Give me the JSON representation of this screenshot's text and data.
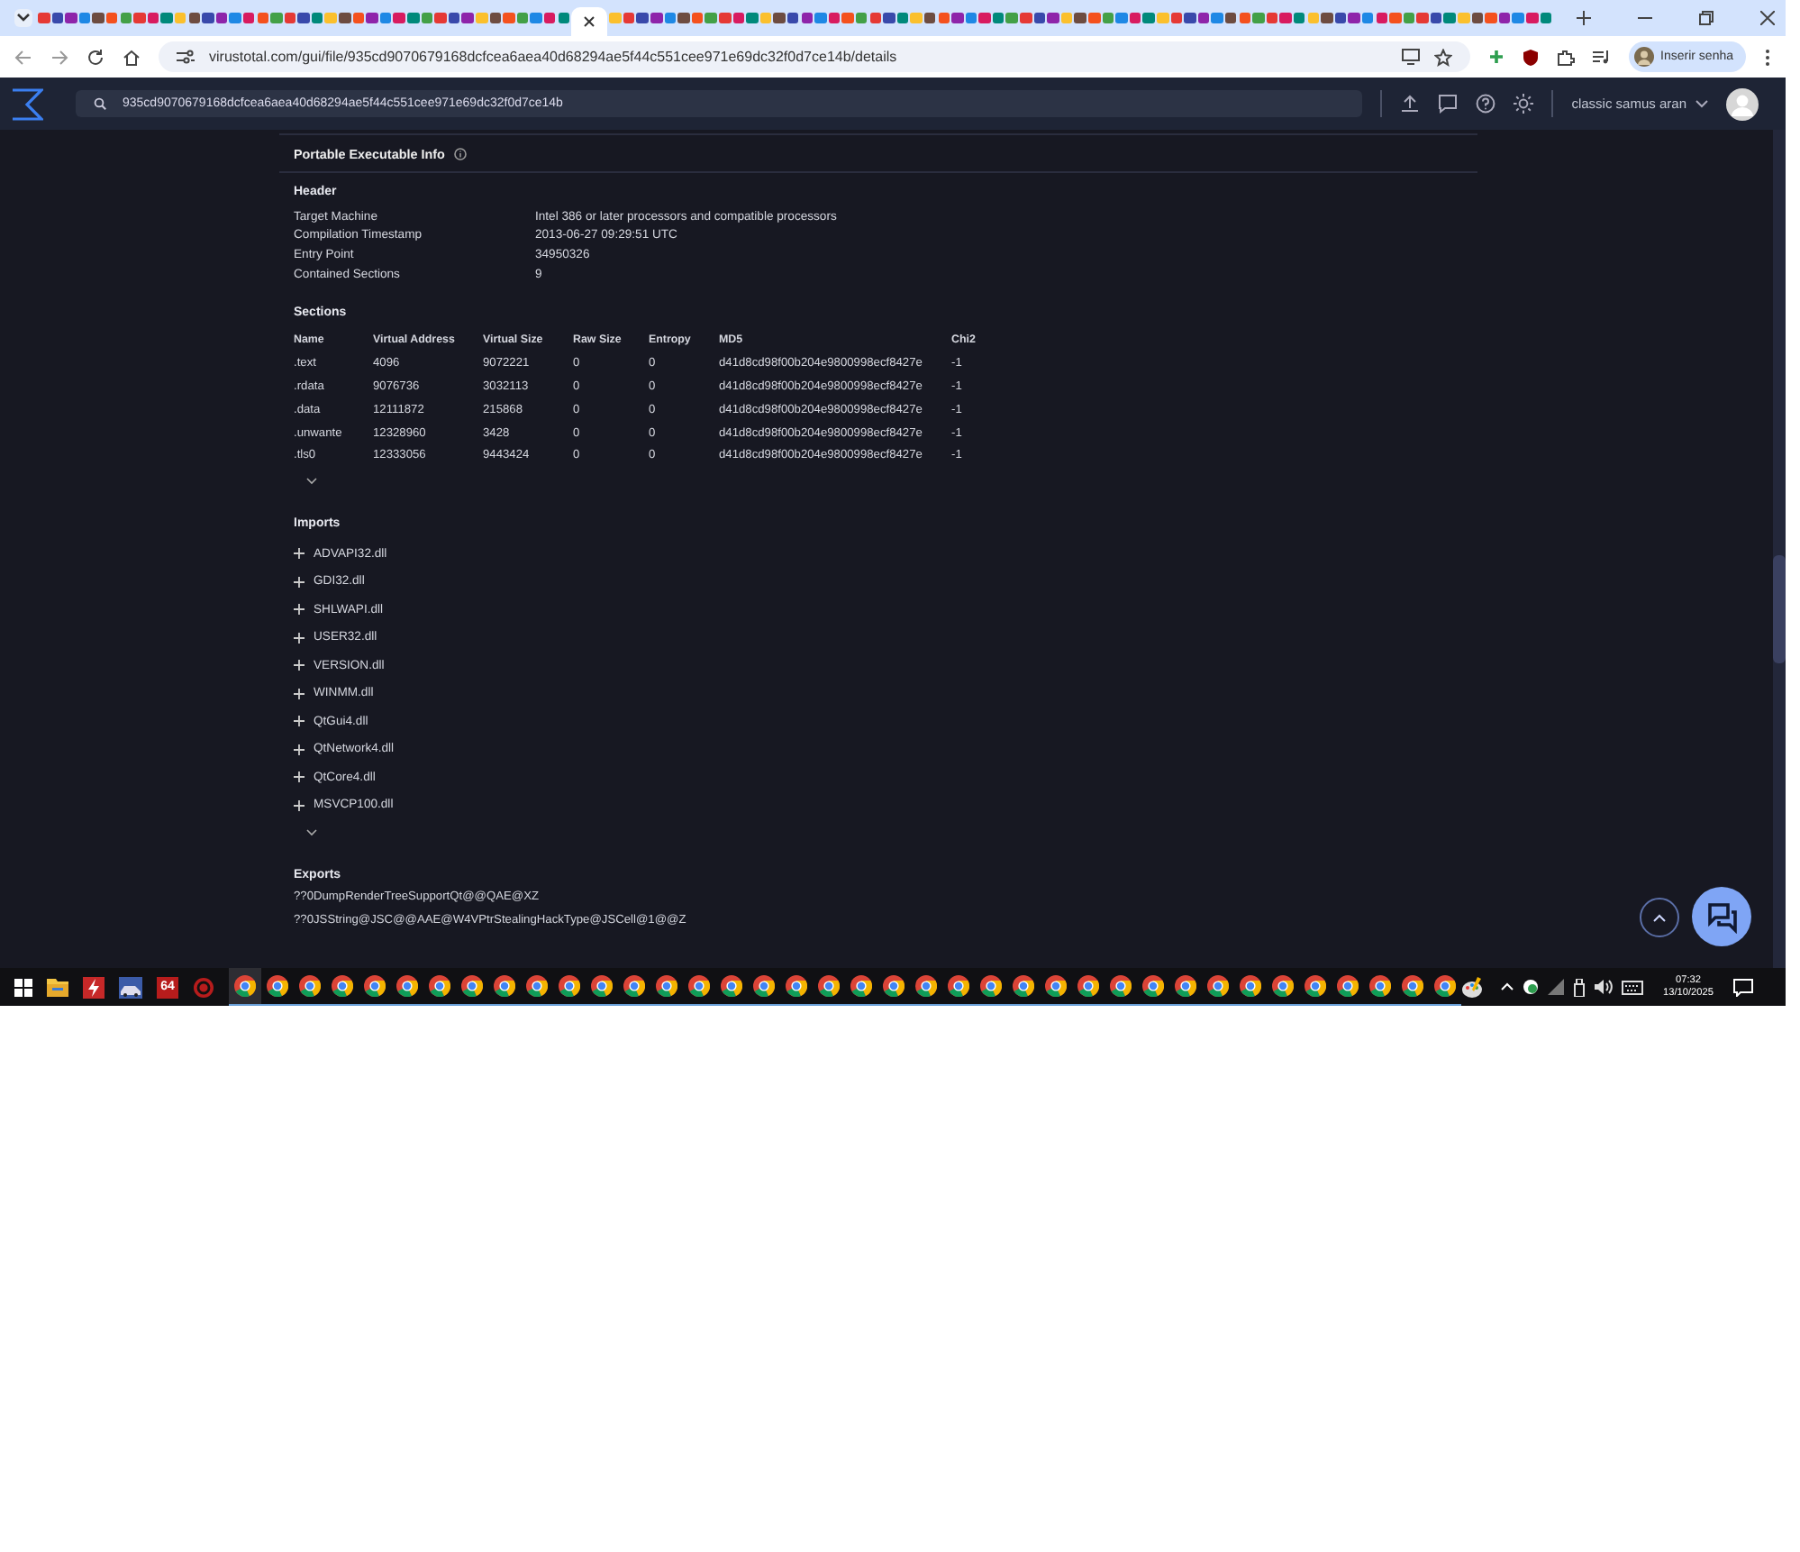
{
  "browser": {
    "url": "virustotal.com/gui/file/935cd9070679168dcfcea6aea40d68294ae5f44c551cee971e69dc32f0d7ce14b/details",
    "profile": "Inserir senha"
  },
  "header": {
    "search": "935cd9070679168dcfcea6aea40d68294ae5f44c551cee971e69dc32f0d7ce14b",
    "user": "classic samus aran"
  },
  "pe_info": {
    "title": "Portable Executable Info",
    "header": {
      "title": "Header",
      "rows": [
        {
          "label": "Target Machine",
          "value": "Intel 386 or later processors and compatible processors"
        },
        {
          "label": "Compilation Timestamp",
          "value": "2013-06-27 09:29:51 UTC"
        },
        {
          "label": "Entry Point",
          "value": "34950326"
        },
        {
          "label": "Contained Sections",
          "value": "9"
        }
      ]
    },
    "sections": {
      "title": "Sections",
      "columns": [
        "Name",
        "Virtual Address",
        "Virtual Size",
        "Raw Size",
        "Entropy",
        "MD5",
        "Chi2"
      ],
      "rows": [
        [
          ".text",
          "4096",
          "9072221",
          "0",
          "0",
          "d41d8cd98f00b204e9800998ecf8427e",
          "-1"
        ],
        [
          ".rdata",
          "9076736",
          "3032113",
          "0",
          "0",
          "d41d8cd98f00b204e9800998ecf8427e",
          "-1"
        ],
        [
          ".data",
          "12111872",
          "215868",
          "0",
          "0",
          "d41d8cd98f00b204e9800998ecf8427e",
          "-1"
        ],
        [
          ".unwante",
          "12328960",
          "3428",
          "0",
          "0",
          "d41d8cd98f00b204e9800998ecf8427e",
          "-1"
        ],
        [
          ".tls0",
          "12333056",
          "9443424",
          "0",
          "0",
          "d41d8cd98f00b204e9800998ecf8427e",
          "-1"
        ]
      ]
    },
    "imports": {
      "title": "Imports",
      "items": [
        {
          "name": "ADVAPI32.dll",
          "expanded": false
        },
        {
          "name": "GDI32.dll",
          "expanded": false
        },
        {
          "name": "SHLWAPI.dll",
          "expanded": false
        },
        {
          "name": "USER32.dll",
          "expanded": false
        },
        {
          "name": "VERSION.dll",
          "expanded": false
        },
        {
          "name": "WINMM.dll",
          "expanded": false
        },
        {
          "name": "QtGui4.dll",
          "expanded": false
        },
        {
          "name": "QtNetwork4.dll",
          "expanded": false
        },
        {
          "name": "QtCore4.dll",
          "expanded": false
        },
        {
          "name": "MSVCP100.dll",
          "expanded": false
        }
      ]
    },
    "exports": {
      "title": "Exports",
      "items": [
        "??0DumpRenderTreeSupportQt@@QAE@XZ",
        "??0JSString@JSC@@AAE@W4VPtrStealingHackType@JSCell@1@@Z"
      ]
    }
  },
  "taskbar": {
    "app_badge": "64",
    "time": "07:32",
    "date": "13/10/2025"
  }
}
